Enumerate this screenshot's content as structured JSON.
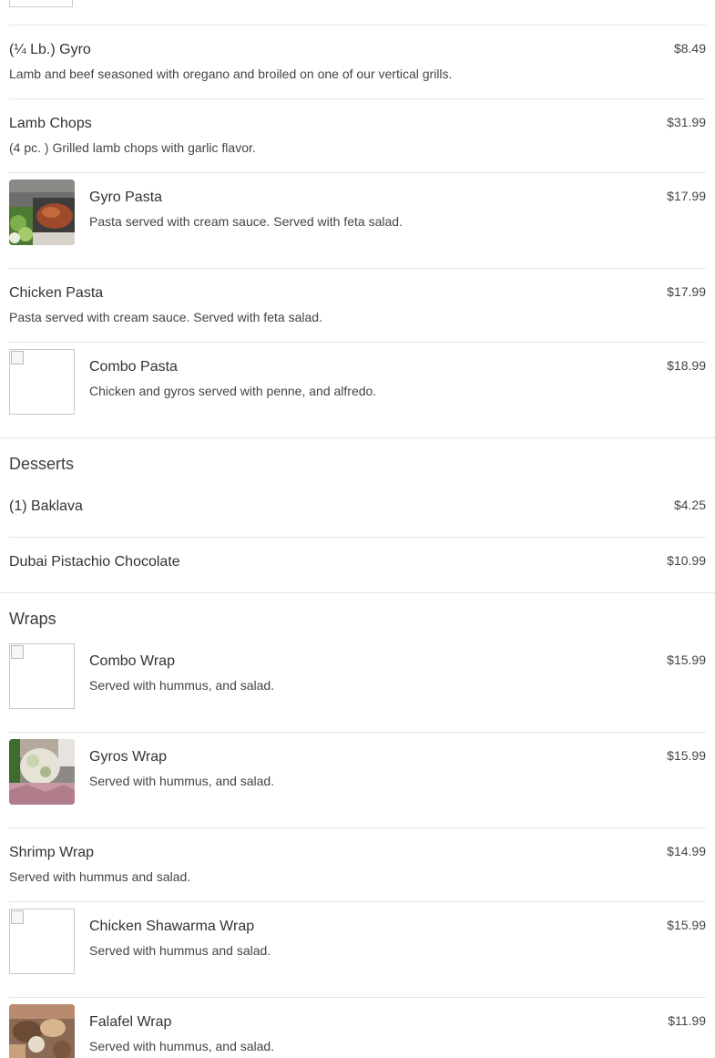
{
  "items_top": [
    {
      "name": "(¼ Lb.) Gyro",
      "desc": "Lamb and beef seasoned with oregano and broiled on one of our vertical grills.",
      "price": "$8.49"
    },
    {
      "name": "Lamb Chops",
      "desc": "(4 pc. ) Grilled lamb chops with garlic flavor.",
      "price": "$31.99"
    },
    {
      "name": "Gyro Pasta",
      "desc": "Pasta served with cream sauce. Served with feta salad.",
      "price": "$17.99"
    },
    {
      "name": "Chicken Pasta",
      "desc": "Pasta served with cream sauce. Served with feta salad.",
      "price": "$17.99"
    },
    {
      "name": "Combo Pasta",
      "desc": "Chicken and gyros served with penne, and alfredo.",
      "price": "$18.99"
    }
  ],
  "desserts": {
    "title": "Desserts",
    "items": [
      {
        "name": "(1) Baklava",
        "price": "$4.25"
      },
      {
        "name": "Dubai Pistachio Chocolate",
        "price": "$10.99"
      }
    ]
  },
  "wraps": {
    "title": "Wraps",
    "items": [
      {
        "name": "Combo Wrap",
        "desc": "Served with hummus, and salad.",
        "price": "$15.99"
      },
      {
        "name": "Gyros Wrap",
        "desc": "Served with hummus, and salad.",
        "price": "$15.99"
      },
      {
        "name": "Shrimp Wrap",
        "desc": "Served with hummus and salad.",
        "price": "$14.99"
      },
      {
        "name": "Chicken Shawarma Wrap",
        "desc": "Served with hummus and salad.",
        "price": "$15.99"
      },
      {
        "name": "Falafel Wrap",
        "desc": "Served with hummus, and salad.",
        "price": "$11.99"
      }
    ]
  },
  "icons": {
    "broken_image": "broken-image-icon"
  }
}
